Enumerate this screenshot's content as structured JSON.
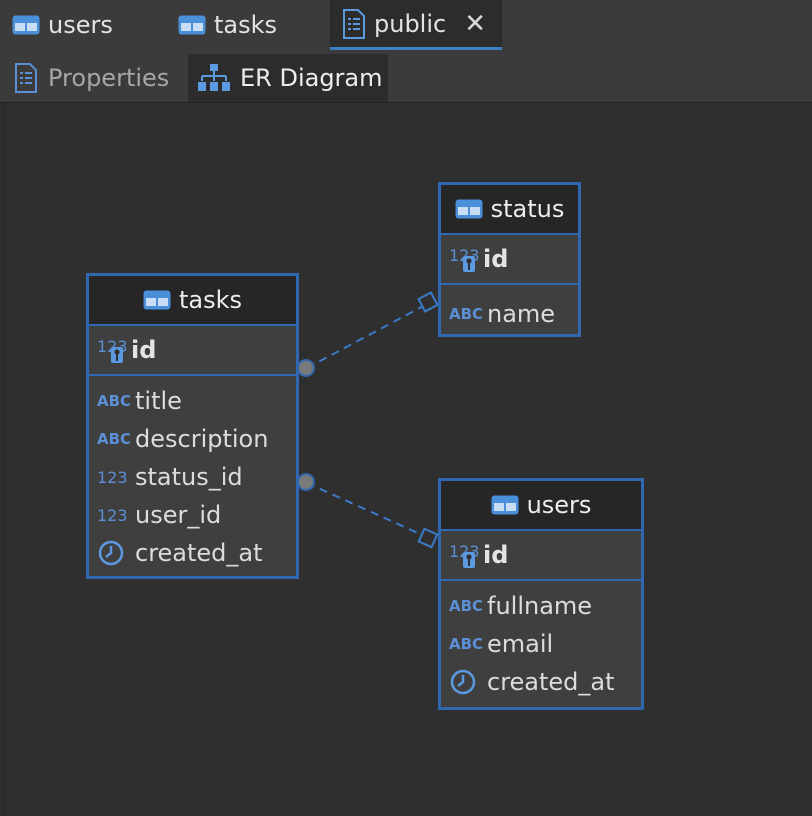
{
  "editor_tabs": [
    {
      "label": "users"
    },
    {
      "label": "tasks"
    },
    {
      "label": "public",
      "active": true
    }
  ],
  "sub_tabs": [
    {
      "label": "Properties",
      "active": false
    },
    {
      "label": "ER Diagram",
      "active": true
    }
  ],
  "colors": {
    "accent": "#2f67b1",
    "type_icon": "#5b8fd6",
    "background": "#2f2f2f"
  },
  "entities": {
    "tasks": {
      "name": "tasks",
      "pk": "id",
      "columns": [
        {
          "name": "title",
          "type_icon": "ABC"
        },
        {
          "name": "description",
          "type_icon": "ABC"
        },
        {
          "name": "status_id",
          "type_icon": "123"
        },
        {
          "name": "user_id",
          "type_icon": "123"
        },
        {
          "name": "created_at",
          "type_icon": "clock-icon"
        }
      ]
    },
    "status": {
      "name": "status",
      "pk": "id",
      "columns": [
        {
          "name": "name",
          "type_icon": "ABC"
        }
      ]
    },
    "users": {
      "name": "users",
      "pk": "id",
      "columns": [
        {
          "name": "fullname",
          "type_icon": "ABC"
        },
        {
          "name": "email",
          "type_icon": "ABC"
        },
        {
          "name": "created_at",
          "type_icon": "clock-icon"
        }
      ]
    }
  },
  "type_labels": {
    "abc": "ABC",
    "num": "123"
  }
}
